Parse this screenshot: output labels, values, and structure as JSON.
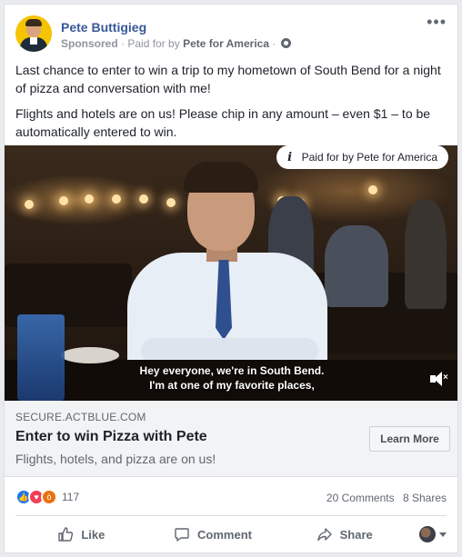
{
  "post": {
    "author": "Pete Buttigieg",
    "sponsored_label": "Sponsored",
    "paid_prefix": "Paid for by",
    "paid_by": "Pete for America",
    "body": [
      "Last chance to enter to win a trip to my hometown of South Bend for a night of pizza and conversation with me!",
      "Flights and hotels are on us! Please chip in any amount – even $1 – to be automatically entered to win."
    ],
    "icons": [
      "more-options-icon",
      "globe-icon"
    ]
  },
  "media": {
    "paid_badge": "Paid for by Pete for America",
    "subtitle_line1": "Hey everyone, we're in South Bend.",
    "subtitle_line2": "I'm at one of my favorite places,",
    "icons": [
      "info-icon",
      "mute-icon"
    ]
  },
  "link_preview": {
    "domain": "SECURE.ACTBLUE.COM",
    "title": "Enter to win Pizza with Pete",
    "description": "Flights, hotels, and pizza are on us!",
    "cta": "Learn More"
  },
  "stats": {
    "reactions": [
      "like",
      "love",
      "angry"
    ],
    "reaction_count": "117",
    "comments": "20 Comments",
    "shares": "8 Shares"
  },
  "actions": {
    "like": "Like",
    "comment": "Comment",
    "share": "Share"
  },
  "colors": {
    "name_link": "#385898",
    "like_blue": "#1877f2",
    "love_red": "#f33e58",
    "angry_orange": "#e9710f"
  }
}
